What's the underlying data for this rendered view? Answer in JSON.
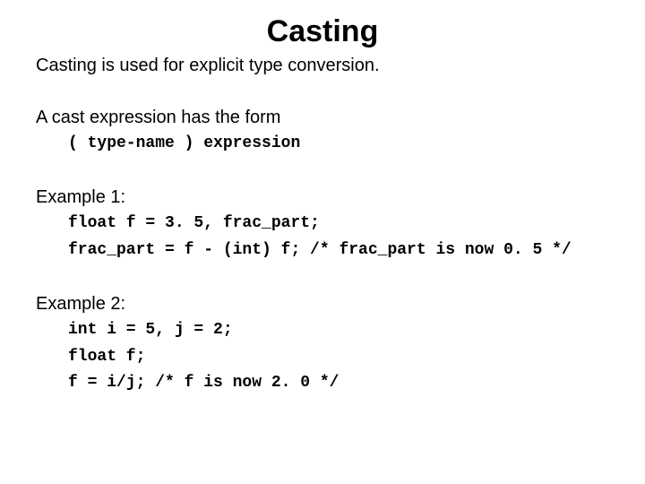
{
  "title": "Casting",
  "intro": "Casting is used for explicit type conversion.",
  "form": {
    "heading": "A cast expression has the form",
    "code": "( type-name ) expression"
  },
  "example1": {
    "heading": "Example 1:",
    "line1": "float f = 3. 5, frac_part;",
    "line2": "frac_part = f - (int) f; /* frac_part is now 0. 5 */"
  },
  "example2": {
    "heading": "Example 2:",
    "line1": "int i = 5, j = 2;",
    "line2": "float f;",
    "line3": "f = i/j; /* f is now 2. 0 */"
  }
}
